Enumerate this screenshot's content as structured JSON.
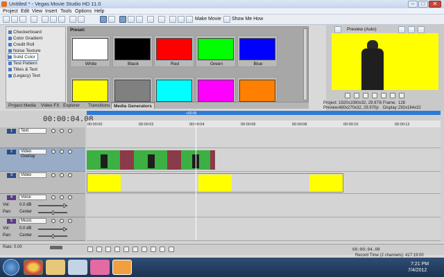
{
  "window": {
    "title": "Untitled * - Vegas Movie Studio HD 11.0",
    "minimize": "–",
    "maximize": "□",
    "close": "✕"
  },
  "menu": [
    "Project",
    "Edit",
    "View",
    "Insert",
    "Tools",
    "Options",
    "Help"
  ],
  "toolbar": {
    "make_movie": "Make Movie",
    "show_me_how": "Show Me How"
  },
  "generators": {
    "items": [
      "Checkerboard",
      "Color Gradient",
      "Credit Roll",
      "Noise Texture",
      "Solid Color",
      "Test Pattern",
      "Titles & Text",
      "(Legacy) Text"
    ],
    "selected": "Solid Color"
  },
  "presets": {
    "heading": "Preset:",
    "row1": [
      {
        "label": "White",
        "color": "#ffffff"
      },
      {
        "label": "Black",
        "color": "#000000"
      },
      {
        "label": "Red",
        "color": "#ff0000"
      },
      {
        "label": "Green",
        "color": "#00ff00"
      },
      {
        "label": "Blue",
        "color": "#0000ff"
      }
    ],
    "row2": [
      {
        "color": "#ffff00"
      },
      {
        "color": "#808080"
      },
      {
        "color": "#00ffff"
      },
      {
        "color": "#ff00ff"
      },
      {
        "color": "#ff8000"
      }
    ]
  },
  "tabs": [
    "Project Media",
    "Video FX",
    "Explorer",
    "Transitions",
    "Media Generators"
  ],
  "active_tab": "Media Generators",
  "preview": {
    "mode": "Preview (Auto)",
    "project_label": "Project:",
    "project_value": "1920x1080x32, 29.970i",
    "preview_label": "Preview:",
    "preview_value": "480x270x32, 29.970p",
    "frame_label": "Frame:",
    "frame_value": "128",
    "display_label": "Display:",
    "display_value": "292x164x32"
  },
  "timeline": {
    "time": "00:00:04.08",
    "ruler": [
      "00:00:00",
      "00:00:02",
      "00:00:04",
      "00:00:06",
      "00:00:08",
      "00:00:10",
      "00:00:12"
    ],
    "cursor_badge": "+00:06",
    "tracks": [
      {
        "num": "1",
        "name": "Text"
      },
      {
        "num": "2",
        "name": "Video Overlay"
      },
      {
        "num": "3",
        "name": "Video"
      },
      {
        "num": "4",
        "name": "Voice",
        "vol": "Vol:",
        "vol_value": "0.0 dB",
        "pan": "Pan:",
        "pan_value": "Center"
      },
      {
        "num": "5",
        "name": "Music",
        "vol": "Vol:",
        "vol_value": "0.0 dB",
        "pan": "Pan:",
        "pan_value": "Center"
      }
    ],
    "rate_label": "Rate: 0.00"
  },
  "transport_time": "00:00:04.08",
  "status": {
    "record_time": "Record Time (2 channels): 417:19:00"
  },
  "taskbar": {
    "time": "7:21 PM",
    "date": "7/4/2012"
  },
  "colors": {
    "accent_yellow": "#ffff00",
    "clip_green": "#3cb043",
    "clip_maroon": "#8b3a4a",
    "track_blue": "#2c4c86"
  }
}
